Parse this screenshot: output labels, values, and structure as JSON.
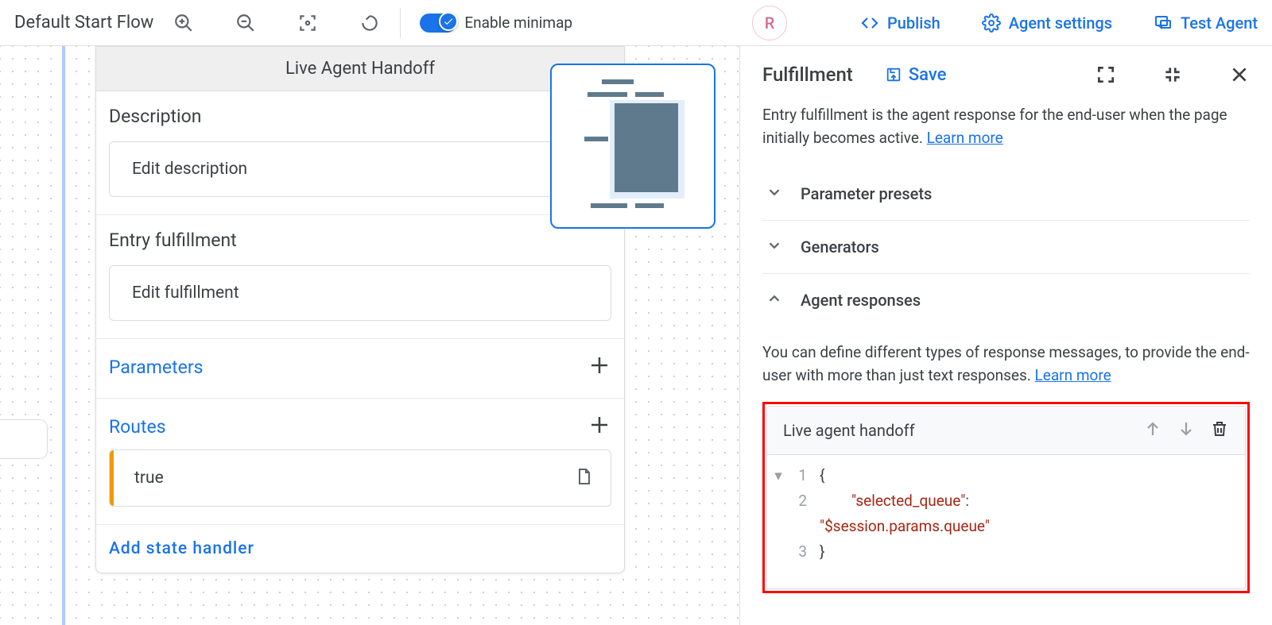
{
  "topbar": {
    "flow_title": "Default Start Flow",
    "minimap_label": "Enable minimap",
    "avatar_initial": "R",
    "publish": "Publish",
    "agent_settings": "Agent settings",
    "test_agent": "Test Agent"
  },
  "node": {
    "title": "Live Agent Handoff",
    "description_heading": "Description",
    "edit_description": "Edit description",
    "entry_heading": "Entry fulfillment",
    "edit_fulfillment": "Edit fulfillment",
    "parameters": "Parameters",
    "routes": "Routes",
    "route_value": "true",
    "add_state": "Add state handler"
  },
  "panel": {
    "title": "Fulfillment",
    "save": "Save",
    "desc_text": "Entry fulfillment is the agent response for the end-user when the page initially becomes active. ",
    "learn_more": "Learn more",
    "acc_presets": "Parameter presets",
    "acc_generators": "Generators",
    "acc_responses": "Agent responses",
    "resp_desc": "You can define different types of response messages, to provide the end-user with more than just text responses. ",
    "resp_card_title": "Live agent handoff",
    "code": {
      "l1": "{",
      "l2a": "\"selected_queue\"",
      "l2b": ":",
      "l2c": "\"$session.params.queue\"",
      "l3": "}"
    },
    "line_numbers": {
      "n1": "1",
      "n2": "2",
      "n3": "3"
    }
  }
}
